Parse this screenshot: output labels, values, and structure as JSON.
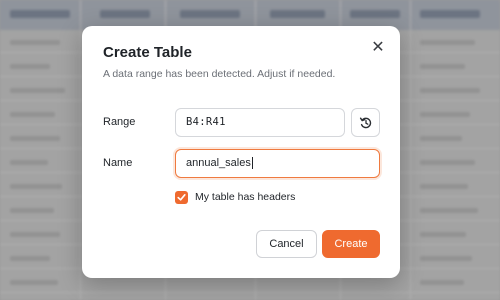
{
  "dialog": {
    "title": "Create Table",
    "subtitle": "A data range has been detected. Adjust if needed.",
    "close_icon": "close-icon",
    "range": {
      "label": "Range",
      "value": "B4:R41",
      "reset_icon": "reset-icon"
    },
    "name": {
      "label": "Name",
      "value": "annual_sales"
    },
    "headers_checkbox": {
      "label": "My table has headers",
      "checked": true
    },
    "buttons": {
      "cancel": "Cancel",
      "create": "Create"
    }
  },
  "colors": {
    "accent": "#ef6a2f",
    "text": "#1f2328",
    "muted": "#6b6f76",
    "overlay": "#9a9a9a"
  }
}
